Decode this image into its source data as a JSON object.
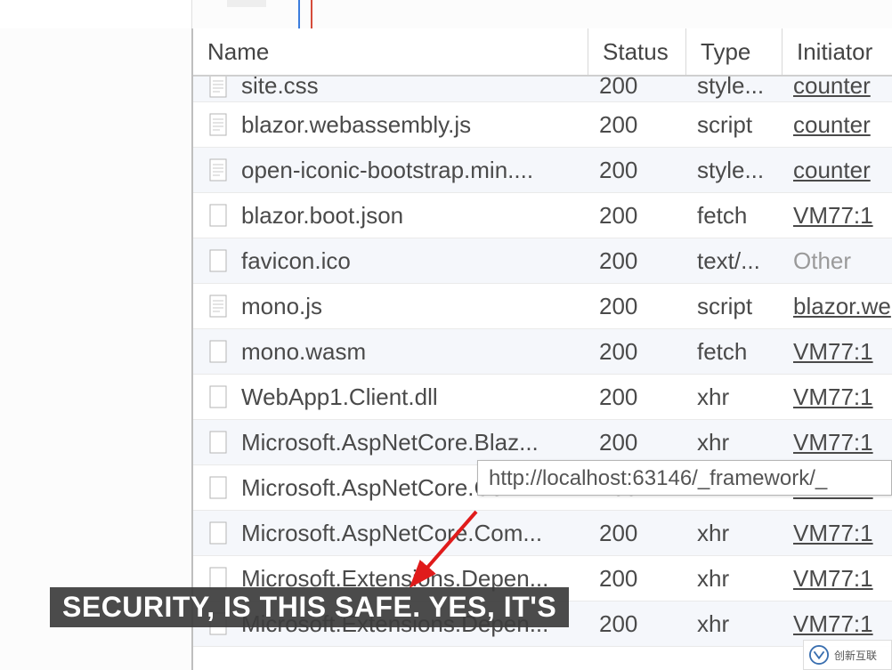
{
  "columns": {
    "name": "Name",
    "status": "Status",
    "type": "Type",
    "initiator": "Initiator"
  },
  "rows": [
    {
      "icon": "doc",
      "name": "site.css",
      "status": "200",
      "type": "style...",
      "initiator": "counter",
      "init_style": "link",
      "cut": true
    },
    {
      "icon": "doc",
      "name": "blazor.webassembly.js",
      "status": "200",
      "type": "script",
      "initiator": "counter",
      "init_style": "link"
    },
    {
      "icon": "doc",
      "name": "open-iconic-bootstrap.min....",
      "status": "200",
      "type": "style...",
      "initiator": "counter",
      "init_style": "link"
    },
    {
      "icon": "blank",
      "name": "blazor.boot.json",
      "status": "200",
      "type": "fetch",
      "initiator": "VM77:1",
      "init_style": "link"
    },
    {
      "icon": "blank",
      "name": "favicon.ico",
      "status": "200",
      "type": "text/...",
      "initiator": "Other",
      "init_style": "muted"
    },
    {
      "icon": "doc",
      "name": "mono.js",
      "status": "200",
      "type": "script",
      "initiator": "blazor.we",
      "init_style": "link"
    },
    {
      "icon": "blank",
      "name": "mono.wasm",
      "status": "200",
      "type": "fetch",
      "initiator": "VM77:1",
      "init_style": "link"
    },
    {
      "icon": "blank",
      "name": "WebApp1.Client.dll",
      "status": "200",
      "type": "xhr",
      "initiator": "VM77:1",
      "init_style": "link"
    },
    {
      "icon": "blank",
      "name": "Microsoft.AspNetCore.Blaz...",
      "status": "200",
      "type": "xhr",
      "initiator": "VM77:1",
      "init_style": "link"
    },
    {
      "icon": "blank",
      "name": "Microsoft.AspNetCore.Com...",
      "status": "200",
      "type": "xhr",
      "initiator": "VM77:1",
      "init_style": "link"
    },
    {
      "icon": "blank",
      "name": "Microsoft.AspNetCore.Com...",
      "status": "200",
      "type": "xhr",
      "initiator": "VM77:1",
      "init_style": "link"
    },
    {
      "icon": "blank",
      "name": "Microsoft.Extensions.Depen...",
      "status": "200",
      "type": "xhr",
      "initiator": "VM77:1",
      "init_style": "link"
    },
    {
      "icon": "blank",
      "name": "Microsoft.Extensions.Depen...",
      "status": "200",
      "type": "xhr",
      "initiator": "VM77:1",
      "init_style": "link"
    }
  ],
  "tooltip": "http://localhost:63146/_framework/_",
  "caption": "SECURITY, IS THIS SAFE. YES, IT'S",
  "watermark": "创新互联"
}
